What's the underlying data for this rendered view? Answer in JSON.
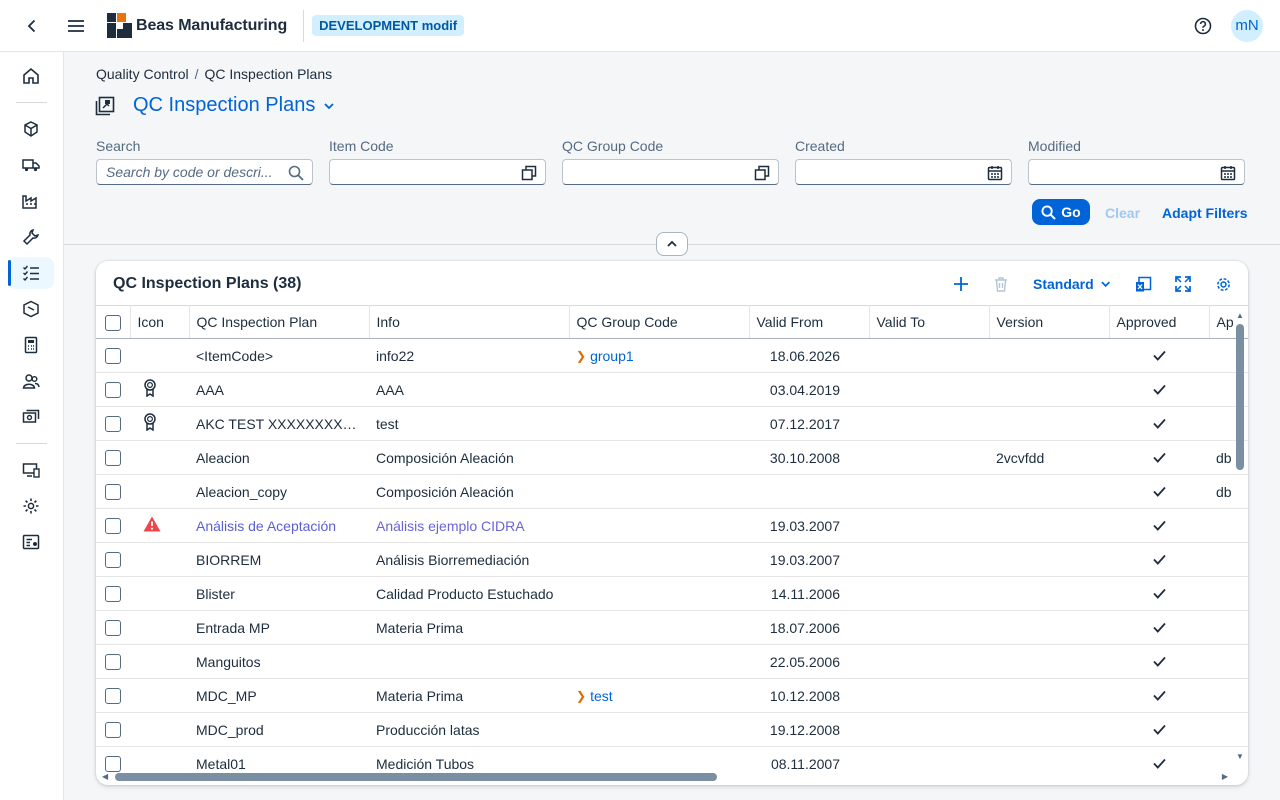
{
  "header": {
    "brand": "Beas Manufacturing",
    "environment": "DEVELOPMENT modif",
    "avatar_initials": "mN"
  },
  "sidebar": {
    "items": [
      {
        "name": "home-icon"
      },
      {
        "name": "cubes-icon"
      },
      {
        "name": "truck-icon"
      },
      {
        "name": "factory-icon"
      },
      {
        "name": "wrench-icon"
      },
      {
        "name": "checklist-icon",
        "active": true
      },
      {
        "name": "package-icon"
      },
      {
        "name": "calculator-icon"
      },
      {
        "name": "people-icon"
      },
      {
        "name": "money-icon"
      },
      {
        "name": "devices-icon"
      },
      {
        "name": "settings-icon"
      },
      {
        "name": "report-icon"
      }
    ]
  },
  "breadcrumb": {
    "parent": "Quality Control",
    "separator": "/",
    "current": "QC Inspection Plans"
  },
  "page": {
    "title": "QC Inspection Plans"
  },
  "filters": {
    "search": {
      "label": "Search",
      "placeholder": "Search by code or descri..."
    },
    "item_code": {
      "label": "Item Code",
      "value": ""
    },
    "qc_group_code": {
      "label": "QC Group Code",
      "value": ""
    },
    "created": {
      "label": "Created",
      "value": ""
    },
    "modified": {
      "label": "Modified",
      "value": ""
    },
    "go_label": "Go",
    "clear_label": "Clear",
    "adapt_label": "Adapt Filters"
  },
  "table": {
    "title": "QC Inspection Plans (38)",
    "variant": "Standard",
    "columns": [
      "Icon",
      "QC Inspection Plan",
      "Info",
      "QC Group Code",
      "Valid From",
      "Valid To",
      "Version",
      "Approved",
      "Ap"
    ],
    "rows": [
      {
        "icon": "",
        "plan": "<ItemCode>",
        "info": "info22",
        "group": "group1",
        "valid_from": "18.06.2026",
        "valid_to": "",
        "version": "",
        "approved": true,
        "extra": ""
      },
      {
        "icon": "award",
        "plan": "AAA",
        "info": "AAA",
        "group": "",
        "valid_from": "03.04.2019",
        "valid_to": "",
        "version": "",
        "approved": true,
        "extra": ""
      },
      {
        "icon": "award",
        "plan": "AKC TEST XXXXXXXXXXXX",
        "info": "test",
        "group": "",
        "valid_from": "07.12.2017",
        "valid_to": "",
        "version": "",
        "approved": true,
        "extra": ""
      },
      {
        "icon": "",
        "plan": "Aleacion",
        "info": "Composición Aleación",
        "group": "",
        "valid_from": "30.10.2008",
        "valid_to": "",
        "version": "2vcvfdd",
        "approved": true,
        "extra": "db"
      },
      {
        "icon": "",
        "plan": "Aleacion_copy",
        "info": "Composición Aleación",
        "group": "",
        "valid_from": "",
        "valid_to": "",
        "version": "",
        "approved": true,
        "extra": "db"
      },
      {
        "icon": "warning",
        "plan": "Análisis de Aceptación",
        "info": "Análisis ejemplo CIDRA",
        "group": "",
        "valid_from": "19.03.2007",
        "valid_to": "",
        "version": "",
        "approved": true,
        "extra": "",
        "highlight": true
      },
      {
        "icon": "",
        "plan": "BIORREM",
        "info": "Análisis Biorremediación",
        "group": "",
        "valid_from": "19.03.2007",
        "valid_to": "",
        "version": "",
        "approved": true,
        "extra": ""
      },
      {
        "icon": "",
        "plan": "Blister",
        "info": "Calidad Producto Estuchado",
        "group": "",
        "valid_from": "14.11.2006",
        "valid_to": "",
        "version": "",
        "approved": true,
        "extra": ""
      },
      {
        "icon": "",
        "plan": "Entrada MP",
        "info": "Materia Prima",
        "group": "",
        "valid_from": "18.07.2006",
        "valid_to": "",
        "version": "",
        "approved": true,
        "extra": ""
      },
      {
        "icon": "",
        "plan": "Manguitos",
        "info": "",
        "group": "",
        "valid_from": "22.05.2006",
        "valid_to": "",
        "version": "",
        "approved": true,
        "extra": ""
      },
      {
        "icon": "",
        "plan": "MDC_MP",
        "info": "Materia Prima",
        "group": "test",
        "valid_from": "10.12.2008",
        "valid_to": "",
        "version": "",
        "approved": true,
        "extra": ""
      },
      {
        "icon": "",
        "plan": "MDC_prod",
        "info": "Producción latas",
        "group": "",
        "valid_from": "19.12.2008",
        "valid_to": "",
        "version": "",
        "approved": true,
        "extra": ""
      },
      {
        "icon": "",
        "plan": "Metal01",
        "info": "Medición Tubos",
        "group": "",
        "valid_from": "08.11.2007",
        "valid_to": "",
        "version": "",
        "approved": true,
        "extra": ""
      }
    ]
  },
  "colors": {
    "accent": "#0064d9",
    "warning": "#e9474b",
    "link": "#5b5fd6"
  }
}
